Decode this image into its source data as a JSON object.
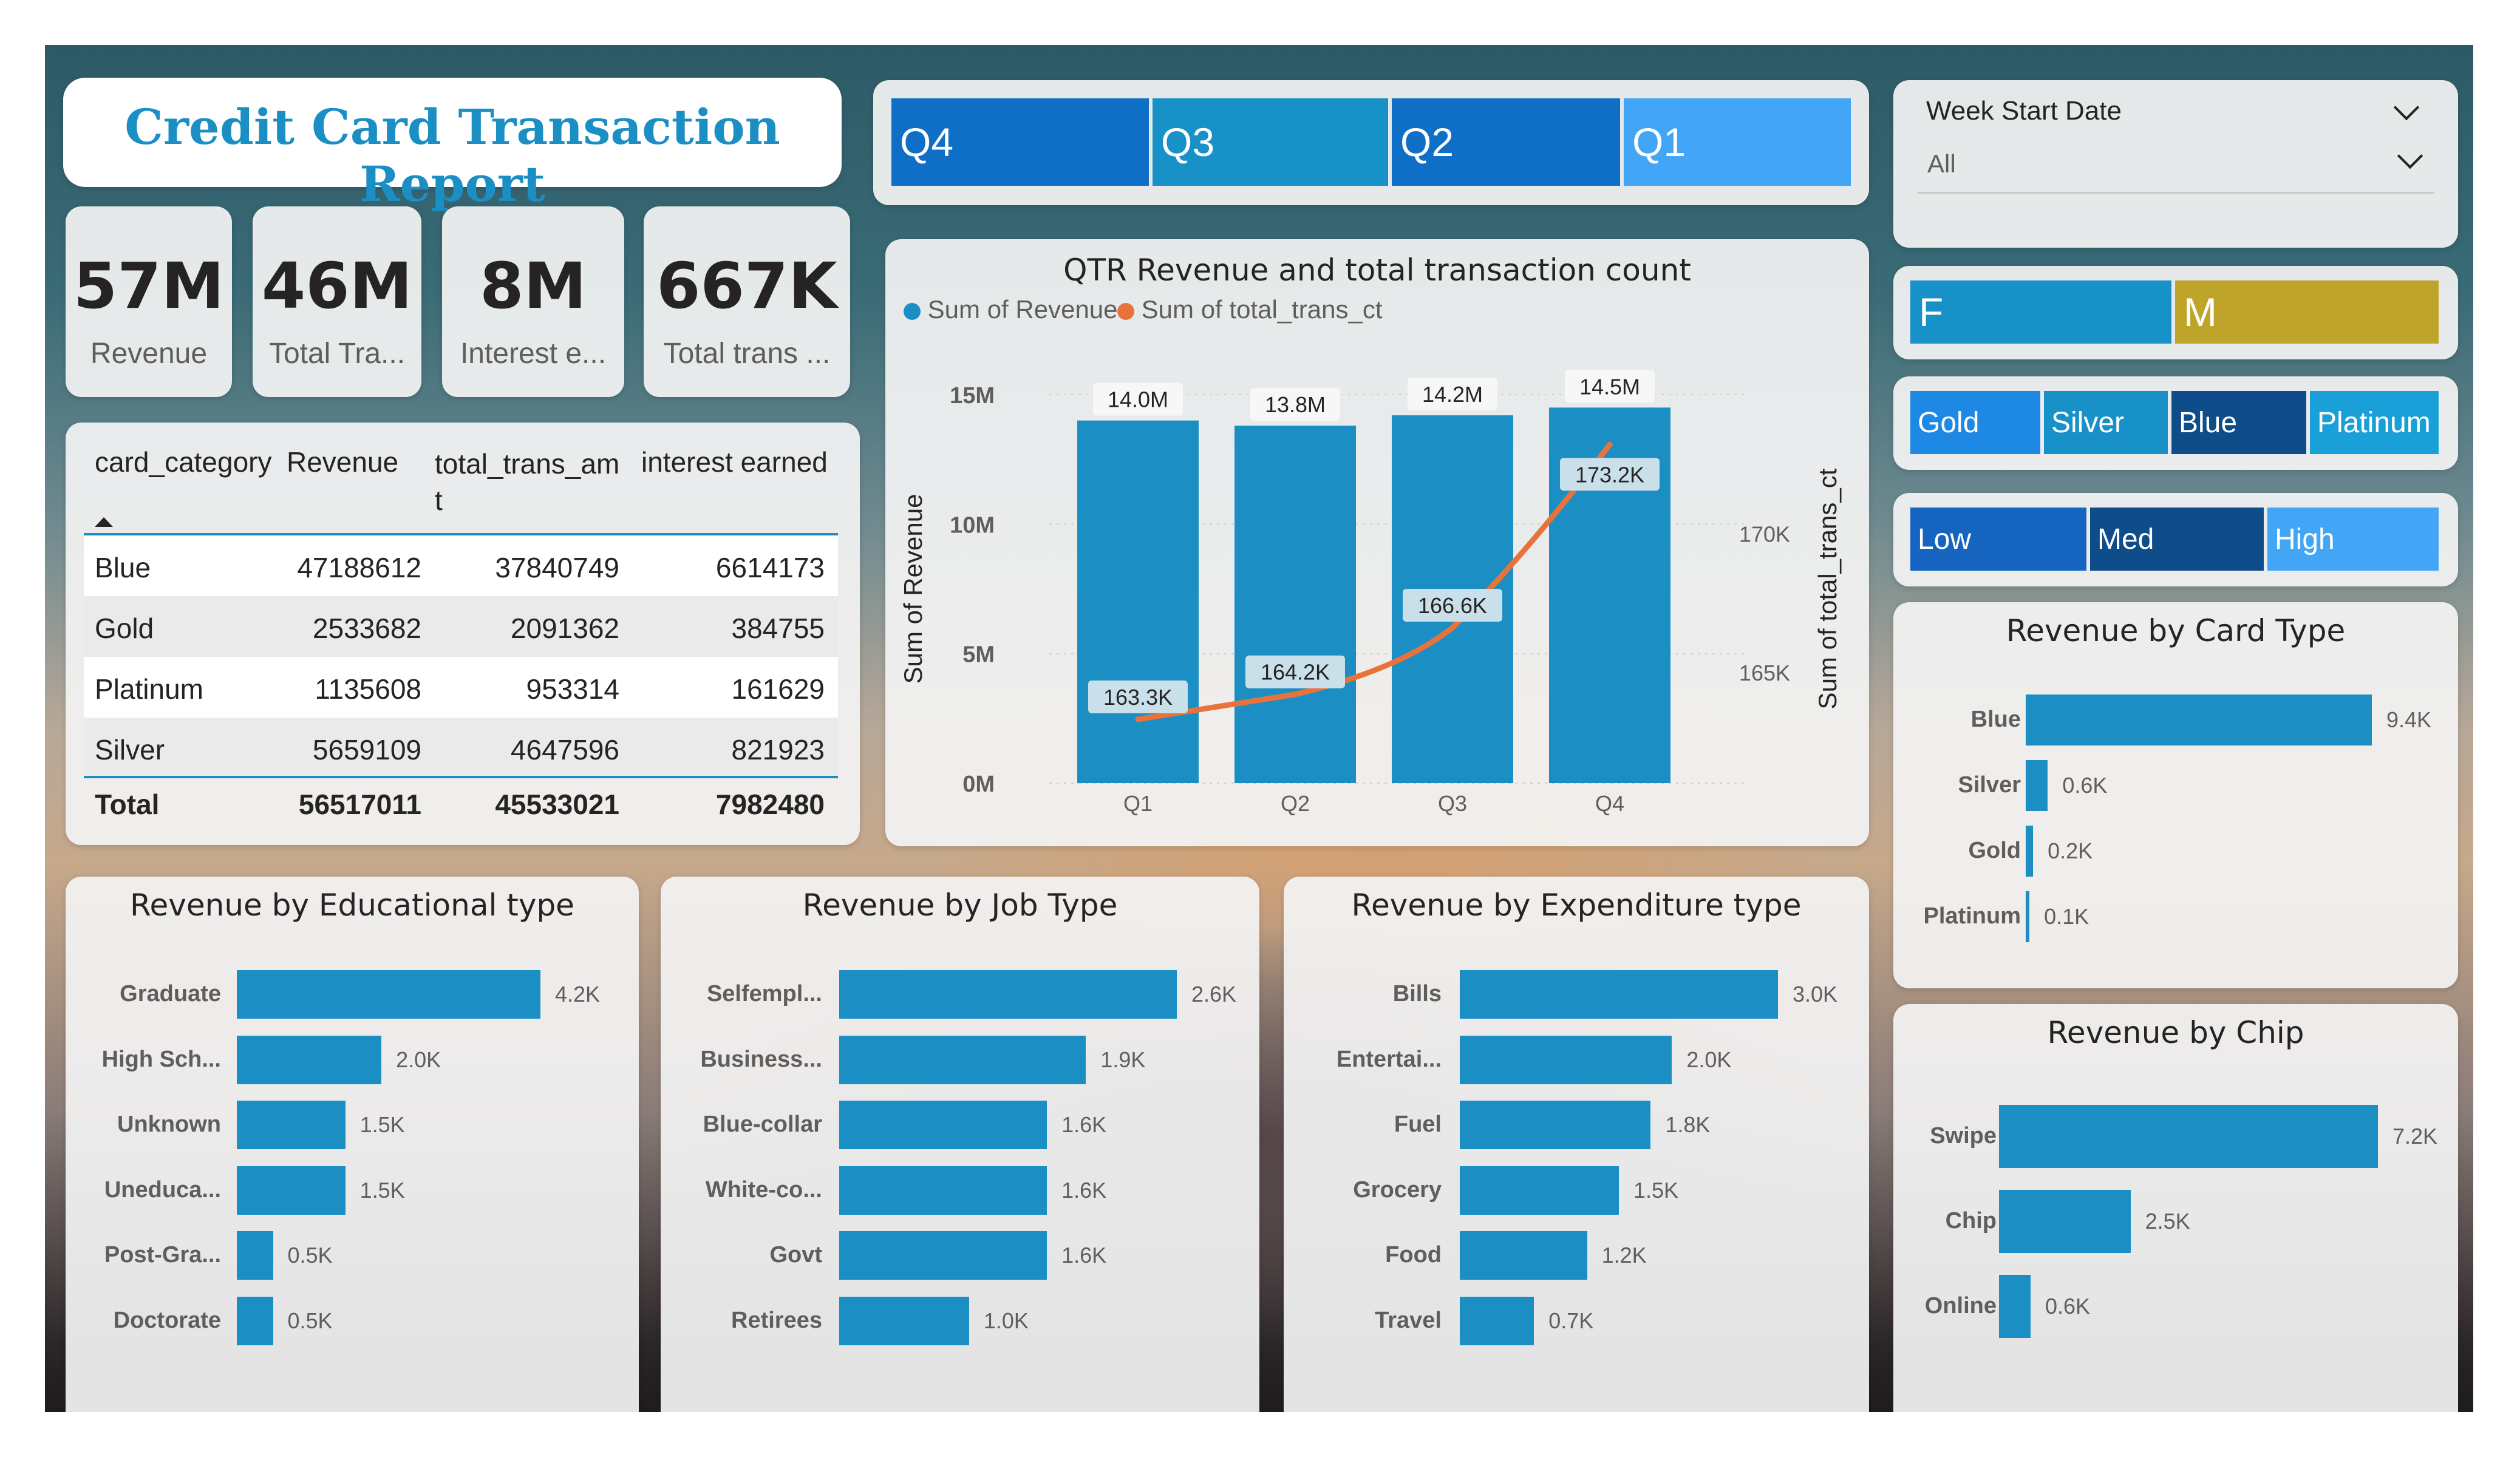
{
  "title": "Credit Card Transaction Report",
  "kpis": [
    {
      "value": "57M",
      "label": "Revenue"
    },
    {
      "value": "46M",
      "label": "Total Tra..."
    },
    {
      "value": "8M",
      "label": "Interest e..."
    },
    {
      "value": "667K",
      "label": "Total trans ..."
    }
  ],
  "quarter_slicer": [
    "Q4",
    "Q3",
    "Q2",
    "Q1"
  ],
  "week_slicer": {
    "title": "Week Start Date",
    "value": "All"
  },
  "gender_slicer": [
    "F",
    "M"
  ],
  "card_slicer": [
    "Gold",
    "Silver",
    "Blue",
    "Platinum"
  ],
  "income_slicer": [
    "Low",
    "Med",
    "High"
  ],
  "colors": {
    "accent": "#1b8fc4",
    "line": "#e8733a",
    "title": "#1b8fc4",
    "gold": "#bfa42a",
    "dark_blue": "#0f4c8a",
    "light_blue": "#3ea6f5"
  },
  "table": {
    "headers": [
      "card_category",
      "Revenue",
      "total_trans_am\nt",
      "interest earned"
    ],
    "sort_icon": "sort-ascending-icon",
    "rows": [
      [
        "Blue",
        "47188612",
        "37840749",
        "6614173"
      ],
      [
        "Gold",
        "2533682",
        "2091362",
        "384755"
      ],
      [
        "Platinum",
        "1135608",
        "953314",
        "161629"
      ],
      [
        "Silver",
        "5659109",
        "4647596",
        "821923"
      ]
    ],
    "total": [
      "Total",
      "56517011",
      "45533021",
      "7982480"
    ]
  },
  "qtr_chart": {
    "title": "QTR Revenue and total transaction count",
    "legend": [
      "Sum of Revenue",
      "Sum of total_trans_ct"
    ],
    "y_left_label": "Sum of Revenue",
    "y_right_label": "Sum of total_trans_ct",
    "y_left_ticks": [
      "0M",
      "5M",
      "10M",
      "15M"
    ],
    "y_right_ticks": [
      "165K",
      "170K"
    ]
  },
  "chart_data": [
    {
      "type": "bar+line",
      "title": "QTR Revenue and total transaction count",
      "categories": [
        "Q1",
        "Q2",
        "Q3",
        "Q4"
      ],
      "series": [
        {
          "name": "Sum of Revenue",
          "type": "bar",
          "values": [
            14.0,
            13.8,
            14.2,
            14.5
          ],
          "labels": [
            "14.0M",
            "13.8M",
            "14.2M",
            "14.5M"
          ],
          "unit": "M"
        },
        {
          "name": "Sum of total_trans_ct",
          "type": "line",
          "values": [
            163.3,
            164.2,
            166.6,
            173.2
          ],
          "labels": [
            "163.3K",
            "164.2K",
            "166.6K",
            "173.2K"
          ],
          "unit": "K"
        }
      ],
      "ylim_left": [
        0,
        15
      ],
      "ylim_right": [
        161,
        175
      ]
    },
    {
      "type": "bar",
      "orientation": "horizontal",
      "title": "Revenue by Card Type",
      "categories": [
        "Blue",
        "Silver",
        "Gold",
        "Platinum"
      ],
      "values": [
        9.4,
        0.6,
        0.2,
        0.1
      ],
      "labels": [
        "9.4K",
        "0.6K",
        "0.2K",
        "0.1K"
      ]
    },
    {
      "type": "bar",
      "orientation": "horizontal",
      "title": "Revenue by Chip",
      "categories": [
        "Swipe",
        "Chip",
        "Online"
      ],
      "values": [
        7.2,
        2.5,
        0.6
      ],
      "labels": [
        "7.2K",
        "2.5K",
        "0.6K"
      ]
    },
    {
      "type": "bar",
      "orientation": "horizontal",
      "title": "Revenue by Educational type",
      "categories": [
        "Graduate",
        "High Sch...",
        "Unknown",
        "Uneduca...",
        "Post-Gra...",
        "Doctorate"
      ],
      "values": [
        4.2,
        2.0,
        1.5,
        1.5,
        0.5,
        0.5
      ],
      "labels": [
        "4.2K",
        "2.0K",
        "1.5K",
        "1.5K",
        "0.5K",
        "0.5K"
      ]
    },
    {
      "type": "bar",
      "orientation": "horizontal",
      "title": "Revenue by Job Type",
      "categories": [
        "Selfempl...",
        "Business...",
        "Blue-collar",
        "White-co...",
        "Govt",
        "Retirees"
      ],
      "values": [
        2.6,
        1.9,
        1.6,
        1.6,
        1.6,
        1.0
      ],
      "labels": [
        "2.6K",
        "1.9K",
        "1.6K",
        "1.6K",
        "1.6K",
        "1.0K"
      ]
    },
    {
      "type": "bar",
      "orientation": "horizontal",
      "title": "Revenue by Expenditure type",
      "categories": [
        "Bills",
        "Entertai...",
        "Fuel",
        "Grocery",
        "Food",
        "Travel"
      ],
      "values": [
        3.0,
        2.0,
        1.8,
        1.5,
        1.2,
        0.7
      ],
      "labels": [
        "3.0K",
        "2.0K",
        "1.8K",
        "1.5K",
        "1.2K",
        "0.7K"
      ]
    }
  ]
}
